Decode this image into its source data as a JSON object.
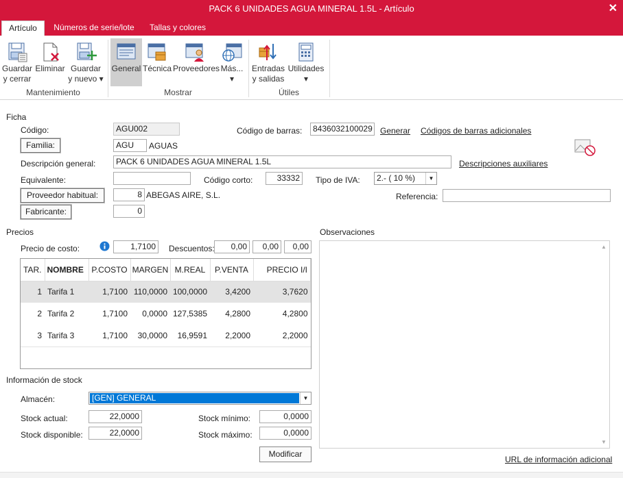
{
  "window": {
    "title": "PACK 6 UNIDADES AGUA MINERAL 1.5L - Artículo",
    "close_glyph": "✕"
  },
  "tabs": [
    {
      "label": "Artículo",
      "active": true
    },
    {
      "label": "Números de serie/lote",
      "active": false
    },
    {
      "label": "Tallas y colores",
      "active": false
    }
  ],
  "ribbon": {
    "buttons": {
      "guardar_cerrar": "Guardar\ny cerrar",
      "eliminar": "Eliminar",
      "guardar_nuevo": "Guardar\ny nuevo ▾",
      "general": "General",
      "tecnica": "Técnica",
      "proveedores": "Proveedores",
      "mas": "Más...\n▾",
      "entradas_salidas": "Entradas\ny salidas",
      "utilidades": "Utilidades\n▾"
    },
    "groups": {
      "mantenimiento": "Mantenimiento",
      "mostrar": "Mostrar",
      "utiles": "Útiles"
    },
    "icons": [
      "save-close-icon",
      "delete-icon",
      "save-new-icon",
      "general-icon",
      "technical-icon",
      "suppliers-icon",
      "more-icon",
      "in-out-icon",
      "utilities-icon"
    ]
  },
  "ficha": {
    "section": "Ficha",
    "codigo_label": "Código:",
    "codigo": "AGU002",
    "barras_label": "Código de barras:",
    "barras": "8436032100029",
    "generar": "Generar",
    "barras_adicionales": "Códigos de barras adicionales",
    "familia_btn": "Familia:",
    "familia_code": "AGU",
    "familia_name": "AGUAS",
    "descripcion_label": "Descripción general:",
    "descripcion": "PACK 6 UNIDADES AGUA MINERAL 1.5L",
    "desc_aux": "Descripciones auxiliares",
    "equivalente_label": "Equivalente:",
    "equivalente": "",
    "codigo_corto_label": "Código corto:",
    "codigo_corto": "33332",
    "iva_label": "Tipo de IVA:",
    "iva": "2.- ( 10 %)",
    "proveedor_btn": "Proveedor habitual:",
    "proveedor_code": "8",
    "proveedor_name": "ABEGAS AIRE, S.L.",
    "referencia_label": "Referencia:",
    "referencia": "",
    "fabricante_btn": "Fabricante:",
    "fabricante": "0"
  },
  "precios": {
    "section": "Precios",
    "costo_label": "Precio de costo:",
    "costo": "1,7100",
    "descuentos_label": "Descuentos:",
    "descuentos": [
      "0,00",
      "0,00",
      "0,00"
    ],
    "columns": [
      "TAR.",
      "NOMBRE",
      "P.COSTO",
      "MARGEN",
      "M.REAL",
      "P.VENTA",
      "PRECIO I/I"
    ],
    "rows": [
      [
        "1",
        "Tarifa 1",
        "1,7100",
        "110,0000",
        "100,0000",
        "3,4200",
        "3,7620"
      ],
      [
        "2",
        "Tarifa 2",
        "1,7100",
        "0,0000",
        "127,5385",
        "4,2800",
        "4,2800"
      ],
      [
        "3",
        "Tarifa 3",
        "1,7100",
        "30,0000",
        "16,9591",
        "2,2000",
        "2,2000"
      ]
    ]
  },
  "observaciones": {
    "section": "Observaciones",
    "text": ""
  },
  "stock": {
    "section": "Información de stock",
    "almacen_label": "Almacén:",
    "almacen": "[GEN] GENERAL",
    "actual_label": "Stock actual:",
    "actual": "22,0000",
    "disponible_label": "Stock disponible:",
    "disponible": "22,0000",
    "minimo_label": "Stock mínimo:",
    "minimo": "0,0000",
    "maximo_label": "Stock máximo:",
    "maximo": "0,0000",
    "modificar": "Modificar"
  },
  "url_adicional": "URL de información adicional",
  "colors": {
    "brand": "#d4173b",
    "selection": "#0078d7"
  }
}
